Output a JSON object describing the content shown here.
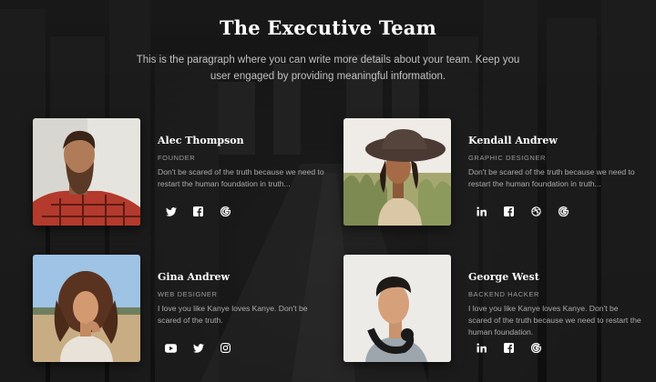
{
  "header": {
    "title": "The Executive Team",
    "description": "This is the paragraph where you can write more details about your team. Keep you user engaged by providing meaningful information."
  },
  "members": [
    {
      "name": "Alec Thompson",
      "role": "FOUNDER",
      "bio": "Don't be scared of the truth because we need to restart the human foundation in truth...",
      "socials": [
        "twitter-icon",
        "facebook-icon",
        "google-icon"
      ]
    },
    {
      "name": "Kendall Andrew",
      "role": "GRAPHIC DESIGNER",
      "bio": "Don't be scared of the truth because we need to restart the human foundation in truth...",
      "socials": [
        "linkedin-icon",
        "facebook-icon",
        "dribbble-icon",
        "google-icon"
      ]
    },
    {
      "name": "Gina Andrew",
      "role": "WEB DESIGNER",
      "bio": "I love you like Kanye loves Kanye. Don't be scared of the truth.",
      "socials": [
        "youtube-icon",
        "twitter-icon",
        "instagram-icon"
      ]
    },
    {
      "name": "George West",
      "role": "BACKEND HACKER",
      "bio": "I love you like Kanye loves Kanye. Don't be scared of the truth because we need to restart the human foundation.",
      "socials": [
        "linkedin-icon",
        "facebook-icon",
        "google-icon"
      ]
    }
  ],
  "colors": {
    "background": "#1a1a1a",
    "text": "#ffffff"
  }
}
